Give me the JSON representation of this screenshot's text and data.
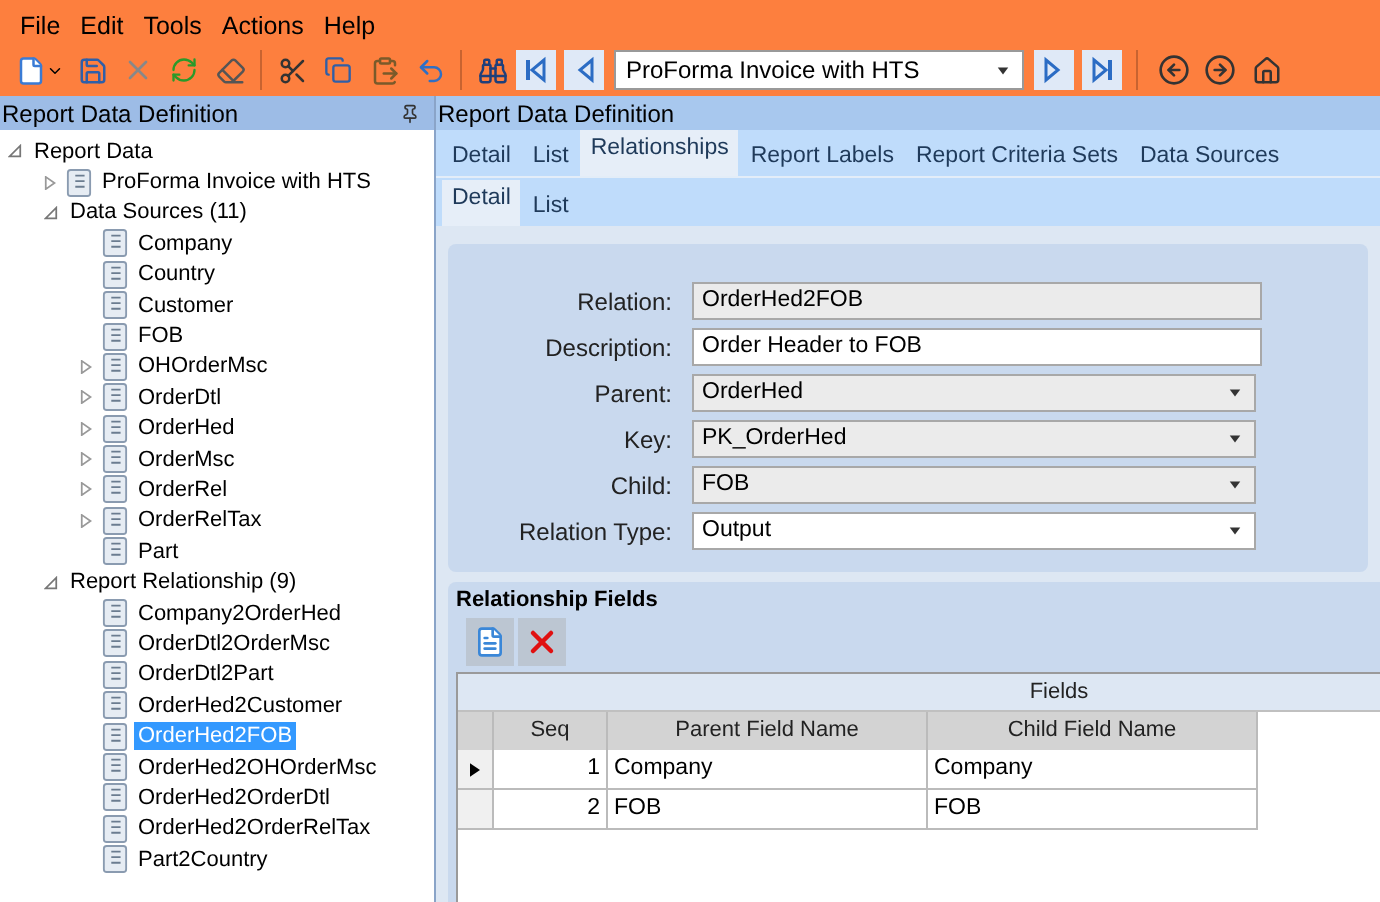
{
  "menu": [
    "File",
    "Edit",
    "Tools",
    "Actions",
    "Help"
  ],
  "toolbar": {
    "report_select": "ProForma Invoice with HTS"
  },
  "left_panel": {
    "title": "Report Data Definition",
    "tree": [
      {
        "label": "Report Data",
        "kind": "group",
        "expanded": true,
        "selected": false,
        "children": [
          {
            "label": "ProForma Invoice with HTS",
            "kind": "table",
            "expanded": false,
            "selected": false
          },
          {
            "label": "Data Sources (11)",
            "kind": "group",
            "expanded": true,
            "selected": false,
            "children": [
              {
                "label": "Company",
                "kind": "table",
                "selected": false
              },
              {
                "label": "Country",
                "kind": "table",
                "selected": false
              },
              {
                "label": "Customer",
                "kind": "table",
                "selected": false
              },
              {
                "label": "FOB",
                "kind": "table",
                "selected": false
              },
              {
                "label": "OHOrderMsc",
                "kind": "table",
                "expanded": false,
                "selected": false
              },
              {
                "label": "OrderDtl",
                "kind": "table",
                "expanded": false,
                "selected": false
              },
              {
                "label": "OrderHed",
                "kind": "table",
                "expanded": false,
                "selected": false
              },
              {
                "label": "OrderMsc",
                "kind": "table",
                "expanded": false,
                "selected": false
              },
              {
                "label": "OrderRel",
                "kind": "table",
                "expanded": false,
                "selected": false
              },
              {
                "label": "OrderRelTax",
                "kind": "table",
                "expanded": false,
                "selected": false
              },
              {
                "label": "Part",
                "kind": "table",
                "selected": false
              }
            ]
          },
          {
            "label": "Report Relationship (9)",
            "kind": "group",
            "expanded": true,
            "selected": false,
            "children": [
              {
                "label": "Company2OrderHed",
                "kind": "table",
                "selected": false
              },
              {
                "label": "OrderDtl2OrderMsc",
                "kind": "table",
                "selected": false
              },
              {
                "label": "OrderDtl2Part",
                "kind": "table",
                "selected": false
              },
              {
                "label": "OrderHed2Customer",
                "kind": "table",
                "selected": false
              },
              {
                "label": "OrderHed2FOB",
                "kind": "table",
                "selected": true
              },
              {
                "label": "OrderHed2OHOrderMsc",
                "kind": "table",
                "selected": false
              },
              {
                "label": "OrderHed2OrderDtl",
                "kind": "table",
                "selected": false
              },
              {
                "label": "OrderHed2OrderRelTax",
                "kind": "table",
                "selected": false
              },
              {
                "label": "Part2Country",
                "kind": "table",
                "selected": false
              }
            ]
          }
        ]
      }
    ]
  },
  "right_panel": {
    "title": "Report Data Definition",
    "tabs": [
      {
        "label": "Detail",
        "selected": false
      },
      {
        "label": "List",
        "selected": false
      },
      {
        "label": "Relationships",
        "selected": true
      },
      {
        "label": "Report Labels",
        "selected": false
      },
      {
        "label": "Report Criteria Sets",
        "selected": false
      },
      {
        "label": "Data Sources",
        "selected": false
      }
    ],
    "sub_tabs": [
      {
        "label": "Detail",
        "selected": true
      },
      {
        "label": "List",
        "selected": false
      }
    ],
    "form": [
      {
        "label": "Relation:",
        "kind": "readonly",
        "value": "OrderHed2FOB"
      },
      {
        "label": "Description:",
        "kind": "text",
        "value": "Order Header to FOB"
      },
      {
        "label": "Parent:",
        "kind": "select",
        "value": "OrderHed"
      },
      {
        "label": "Key:",
        "kind": "select",
        "value": "PK_OrderHed"
      },
      {
        "label": "Child:",
        "kind": "select",
        "value": "FOB"
      },
      {
        "label": "Relation Type:",
        "kind": "select-white",
        "value": "Output"
      }
    ],
    "relationship_fields": {
      "title": "Relationship Fields",
      "band": "Fields",
      "columns": [
        "Seq",
        "Parent Field Name",
        "Child Field Name"
      ],
      "rows": [
        {
          "selected": true,
          "cells": [
            "1",
            "Company",
            "Company"
          ]
        },
        {
          "selected": false,
          "cells": [
            "2",
            "FOB",
            "FOB"
          ]
        }
      ]
    }
  }
}
